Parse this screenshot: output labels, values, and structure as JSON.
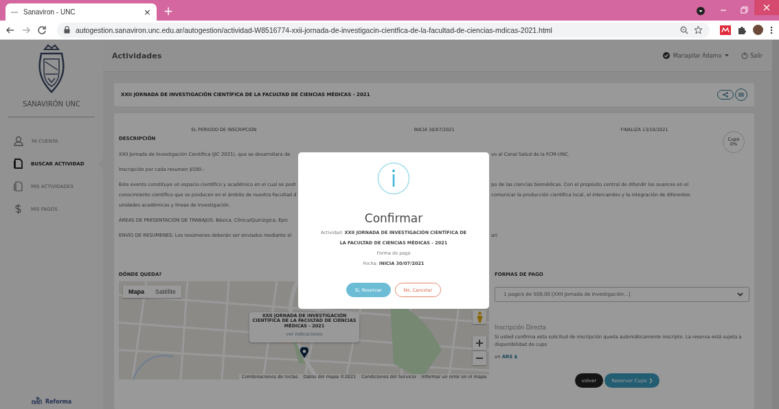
{
  "browser": {
    "tab": {
      "title": "Sanaviron - UNC",
      "close": "×"
    },
    "new_tab": "+",
    "url": "autogestion.sanaviron.unc.edu.ar/autogestion/actividad-W8516774-xxii-jornada-de-investigacin-cientfica-de-la-facultad-de-ciencias-mdicas-2021.html"
  },
  "sidebar": {
    "brand": "SANAVIRÓN UNC",
    "items": [
      {
        "label": "MI CUENTA",
        "selected": false
      },
      {
        "label": "BUSCAR ACTIVIDAD",
        "selected": true
      },
      {
        "label": "MIS ACTIVIDADES",
        "selected": false
      },
      {
        "label": "MIS PAGOS",
        "selected": false
      }
    ],
    "footer_logo": "Reforma"
  },
  "header": {
    "title": "Actividades",
    "user": "Mariapilar Adamo",
    "logout": "Salir"
  },
  "activity": {
    "title": "XXII JORNADA DE INVESTIGACIÓN CIENTÍFICA DE LA FACULTAD DE CIENCIAS MÉDICAS - 2021"
  },
  "period": [
    "EL PERIODO DE INSCRIPCIÓN",
    "INICIA 30/07/2021",
    "FINALIZA 13/10/2021"
  ],
  "cupo": {
    "label": "Cupo",
    "value": "0%"
  },
  "description": {
    "heading": "DESCRIPCIÓN",
    "paragraphs": [
      [
        {
          "left": "XXII Jornada de Investigación Científica (JIC 2021), que se desarrollara de",
          "right": "vo al Canal Salud de la FCM-UNC."
        }
      ],
      [
        {
          "left": "Inscripción por cada resumen $500.-"
        }
      ],
      [
        {
          "left": "Este evento constituye un espacio científico y académico en el cual se podr",
          "right": "po de las ciencias biomédicas. Con el propósito central de difundir los avances en el"
        },
        {
          "left": "conocimiento científico que se producen en el ámbito de nuestra Facultad d",
          "right": "comunicar la producción científica local, el intercambio y la integración de diferentes"
        },
        {
          "left": "unidades académicas y líneas de investigación."
        }
      ],
      [
        {
          "left": "ÁREAS DE PRESENTACIÓN DE TRABAJOS: Básica, Clínica/Quirúrgica, Epic"
        }
      ],
      [
        {
          "left": "ENVÍO DE RESUMENES: Los resúmenes deberán ser enviados mediante el",
          "right": "ar/"
        }
      ]
    ]
  },
  "location": {
    "heading": "DÓNDE QUEDA?",
    "map_types": [
      {
        "label": "Mapa",
        "selected": true
      },
      {
        "label": "Satélite",
        "selected": false
      }
    ],
    "info_title": "XXII JORNADA DE INVESTIGACIÓN CIENTÍFICA DE LA FACULTAD DE CIENCIAS MÉDICAS - 2021",
    "directions": "ver indicaciones",
    "footer": [
      "Combinaciones de teclas",
      "Datos del mapa ©2021",
      "Condiciones del Servicio",
      "Informar un error en el mapa"
    ]
  },
  "payment": {
    "heading": "FORMAS DE PAGO",
    "option": "1 pago/s de 500,00 [XXII Jornada de Investigación...]",
    "mode_title": "Inscripción Directa",
    "mode_text": "Si usted confirma esta solicitud de inscripción queda automáticamente inscripto. La reserva está sujeta a disponibilidad de cupo",
    "currency": "en **ARS $**"
  },
  "actions": [
    {
      "label": "volver",
      "kind": "secondary"
    },
    {
      "label": "Reservar Cupo",
      "kind": "primary"
    }
  ],
  "dialog": {
    "title": "Confirmar",
    "activity": "Actividad: **XXII JORNADA DE INVESTIGACIÓN CIENTÍFICA DE LA FACULTAD DE CIENCIAS MÉDICAS - 2021**",
    "payment": "Forma de pago",
    "date": "Fecha: **INICIA 30/07/2021**",
    "buttons": [
      {
        "label": "Si, Reservar",
        "kind": "confirm"
      },
      {
        "label": "No, Cancelar",
        "kind": "cancel"
      }
    ]
  }
}
